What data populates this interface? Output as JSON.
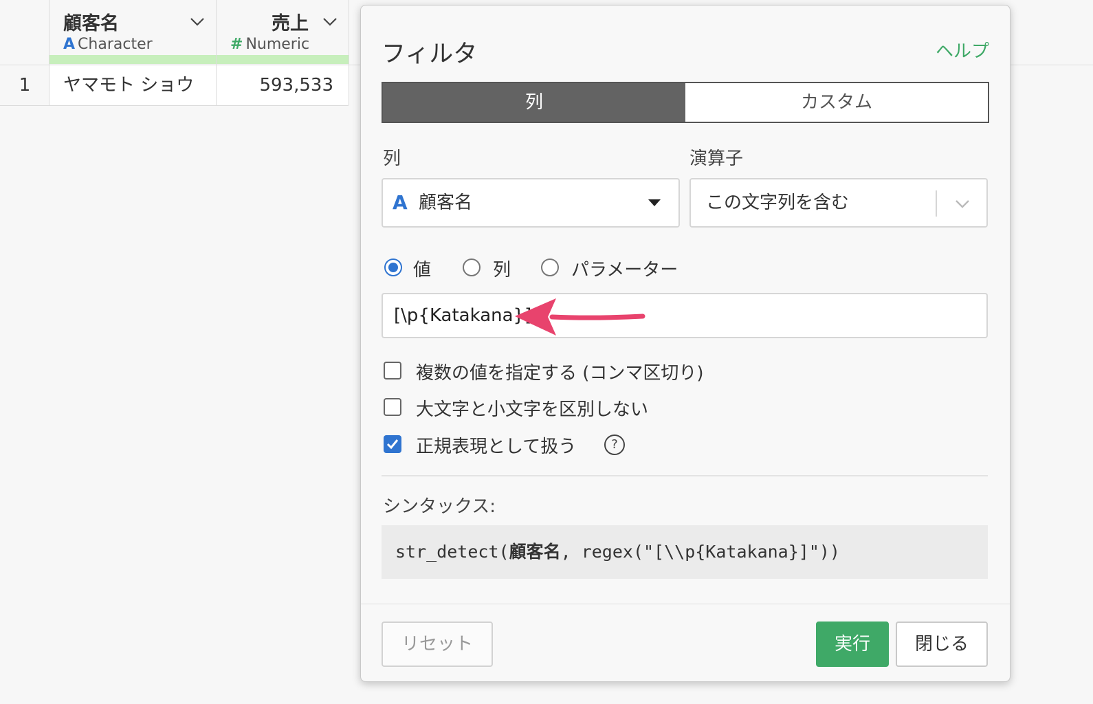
{
  "table": {
    "columns": [
      {
        "name": "顧客名",
        "type_icon": "A",
        "type_label": "Character",
        "type_color": "#2f74d0"
      },
      {
        "name": "売上",
        "type_icon": "#",
        "type_label": "Numeric",
        "type_color": "#3fa967"
      }
    ],
    "rows": [
      {
        "index": "1",
        "customer": "ヤマモト ショウ",
        "sales": "593,533"
      }
    ]
  },
  "dialog": {
    "title": "フィルタ",
    "help_link": "ヘルプ",
    "tabs": [
      {
        "label": "列",
        "active": true
      },
      {
        "label": "カスタム",
        "active": false
      }
    ],
    "column_label": "列",
    "column_select": {
      "type_icon": "A",
      "value": "顧客名"
    },
    "operator_label": "演算子",
    "operator_select": {
      "value": "この文字列を含む"
    },
    "value_source": {
      "options": [
        "値",
        "列",
        "パラメーター"
      ],
      "selected": "値"
    },
    "value_input": "[\\p{Katakana}]",
    "checkboxes": [
      {
        "label": "複数の値を指定する (コンマ区切り)",
        "checked": false
      },
      {
        "label": "大文字と小文字を区別しない",
        "checked": false
      },
      {
        "label": "正規表現として扱う",
        "checked": true
      }
    ],
    "regex_help_icon": "?",
    "syntax_label": "シンタックス:",
    "syntax": {
      "prefix": "str_detect(",
      "column": "顧客名",
      "suffix": ", regex(\"[\\\\p{Katakana}]\"))"
    },
    "buttons": {
      "reset": "リセット",
      "run": "実行",
      "close": "閉じる"
    }
  },
  "colors": {
    "accent_green": "#3fa967",
    "accent_blue": "#2f74d0",
    "arrow_pink": "#e8436d",
    "tab_active_bg": "#636363"
  }
}
